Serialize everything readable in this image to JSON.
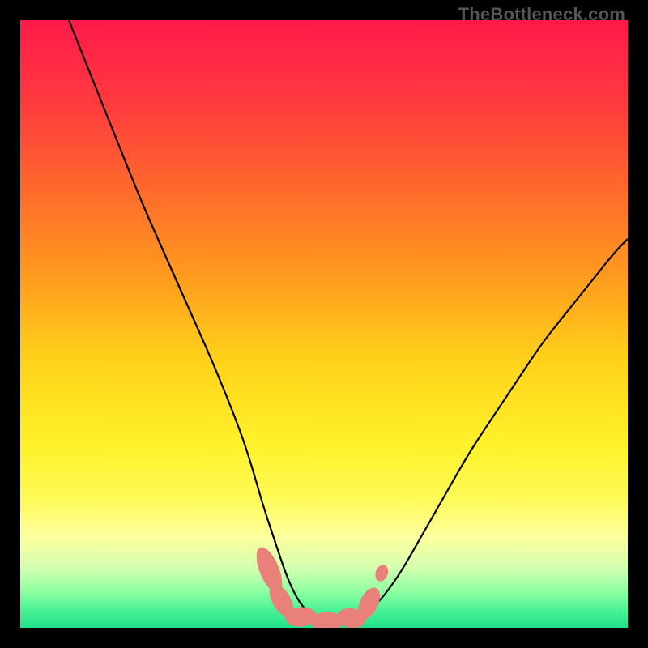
{
  "watermark": "TheBottleneck.com",
  "chart_data": {
    "type": "line",
    "title": "",
    "xlabel": "",
    "ylabel": "",
    "xlim": [
      0,
      100
    ],
    "ylim": [
      0,
      100
    ],
    "gradient_stops": [
      {
        "offset": 0.0,
        "color": "#ff1a4b"
      },
      {
        "offset": 0.14,
        "color": "#ff3b3e"
      },
      {
        "offset": 0.28,
        "color": "#ff6a2c"
      },
      {
        "offset": 0.42,
        "color": "#ff9a1e"
      },
      {
        "offset": 0.56,
        "color": "#ffd21a"
      },
      {
        "offset": 0.7,
        "color": "#fff22a"
      },
      {
        "offset": 0.79,
        "color": "#fffb5a"
      },
      {
        "offset": 0.85,
        "color": "#fcff9e"
      },
      {
        "offset": 0.9,
        "color": "#d6ffb0"
      },
      {
        "offset": 0.94,
        "color": "#8effa2"
      },
      {
        "offset": 0.97,
        "color": "#4cf296"
      },
      {
        "offset": 1.0,
        "color": "#1fe28a"
      }
    ],
    "series": [
      {
        "name": "bottleneck-curve",
        "stroke": "#000000",
        "x": [
          8,
          12,
          16,
          20,
          24,
          28,
          32,
          36,
          38,
          40,
          42,
          44,
          46,
          48,
          50,
          54,
          58,
          62,
          66,
          70,
          74,
          78,
          82,
          86,
          90,
          94,
          98,
          100
        ],
        "y": [
          100,
          90,
          80,
          70,
          61,
          52,
          43,
          33,
          27,
          20,
          14,
          8,
          4,
          2,
          1,
          1,
          3,
          8,
          15,
          22,
          29,
          35,
          41,
          47,
          52,
          57,
          62,
          64
        ]
      }
    ],
    "markers": [
      {
        "name": "lobe-left-top",
        "x": 41.0,
        "y": 9.5,
        "rx": 1.6,
        "ry": 4.0,
        "rotate": -22,
        "fill": "#e98079"
      },
      {
        "name": "lobe-left-mid",
        "x": 43.0,
        "y": 4.5,
        "rx": 1.5,
        "ry": 3.0,
        "rotate": -30,
        "fill": "#e98079"
      },
      {
        "name": "lobe-bottom-1",
        "x": 46.2,
        "y": 1.8,
        "rx": 2.6,
        "ry": 1.6,
        "rotate": -5,
        "fill": "#e98079"
      },
      {
        "name": "lobe-bottom-2",
        "x": 50.5,
        "y": 1.0,
        "rx": 2.6,
        "ry": 1.6,
        "rotate": 0,
        "fill": "#e98079"
      },
      {
        "name": "lobe-bottom-3",
        "x": 54.5,
        "y": 1.6,
        "rx": 2.4,
        "ry": 1.6,
        "rotate": 8,
        "fill": "#e98079"
      },
      {
        "name": "lobe-right-mid",
        "x": 57.4,
        "y": 4.0,
        "rx": 1.5,
        "ry": 2.8,
        "rotate": 25,
        "fill": "#e98079"
      },
      {
        "name": "lobe-right-dot",
        "x": 59.5,
        "y": 9.0,
        "rx": 1.0,
        "ry": 1.4,
        "rotate": 20,
        "fill": "#e98079"
      }
    ]
  }
}
